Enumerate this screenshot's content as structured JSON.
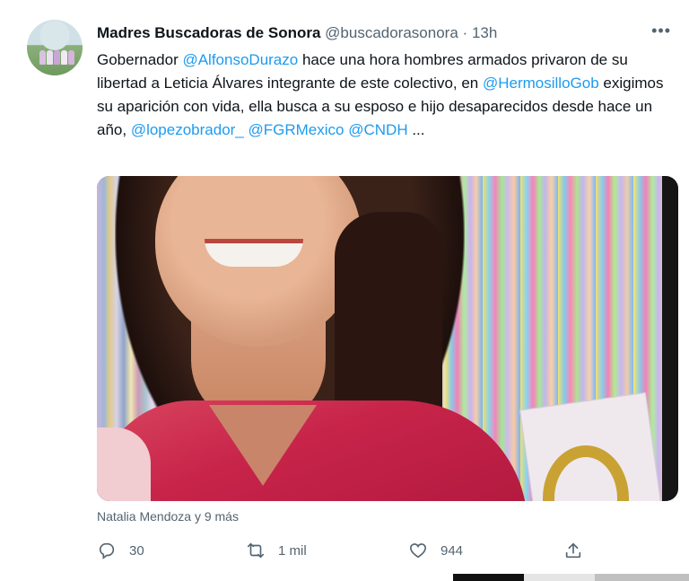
{
  "tweet": {
    "author_name": "Madres Buscadoras de Sonora",
    "handle": "@buscadorasonora",
    "separator": "·",
    "time": "13h",
    "more_label": "•••",
    "text_segments": {
      "p1": "Gobernador ",
      "m1": "@AlfonsoDurazo",
      "p2": "  hace una hora hombres armados privaron de su libertad a Leticia Álvares integrante de este colectivo, en ",
      "m2": "@HermosilloGob",
      "p3": " exigimos su aparición con vida, ella busca a su esposo e hijo desaparecidos desde hace un año, ",
      "m3": "@lopezobrador_",
      "p4": " ",
      "m4": "@FGRMexico",
      "p5": " ",
      "m5": "@CNDH",
      "p6": " ..."
    },
    "social_context": "Natalia Mendoza y 9 más",
    "actions": {
      "replies": "30",
      "retweets": "1 mil",
      "likes": "944"
    }
  },
  "icons": {
    "reply": "reply-icon",
    "retweet": "retweet-icon",
    "like": "heart-icon",
    "share": "share-icon",
    "more": "more-icon"
  },
  "colors": {
    "link": "#1d9bf0",
    "secondary_text": "#536471",
    "primary_text": "#0f1419"
  }
}
